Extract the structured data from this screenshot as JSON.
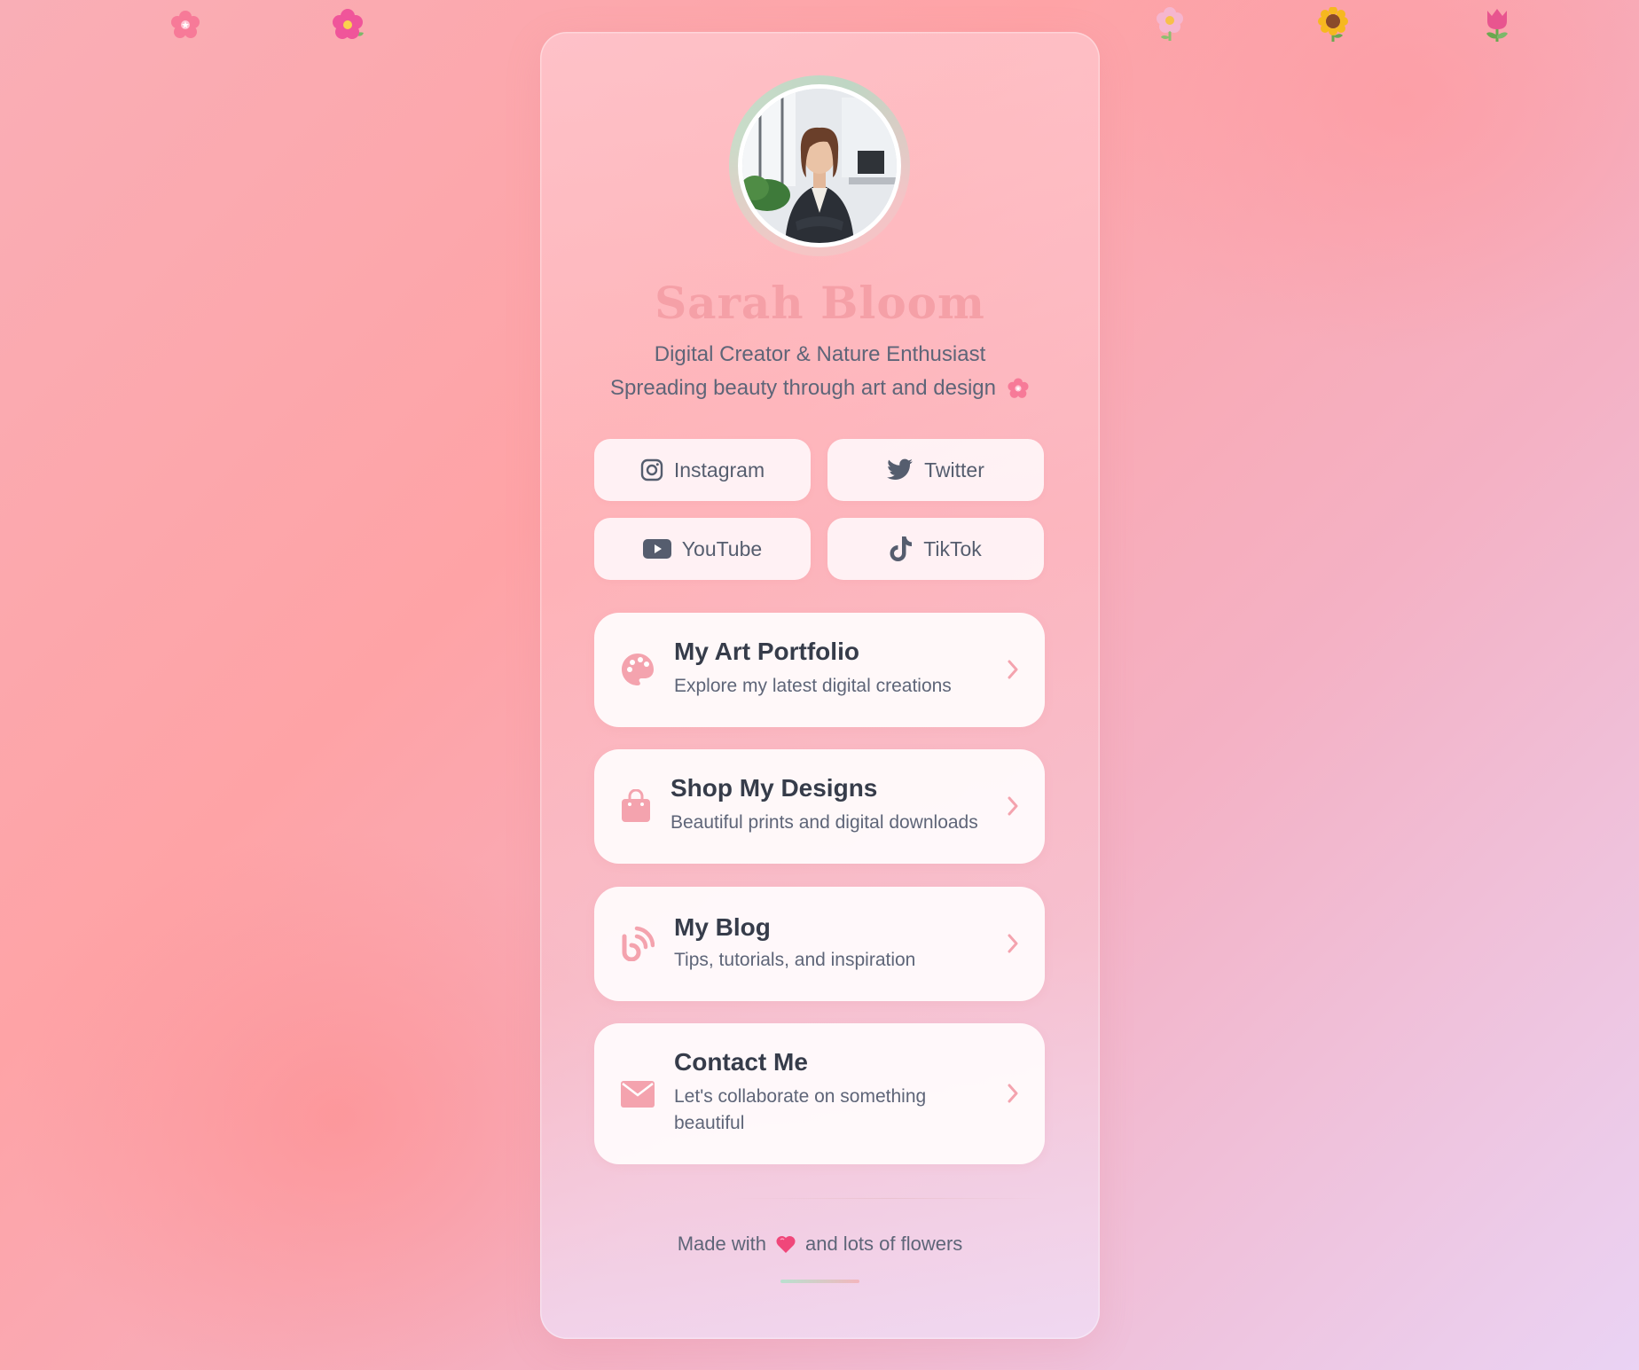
{
  "profile": {
    "name": "Sarah Bloom",
    "tagline_line1": "Digital Creator & Nature Enthusiast",
    "tagline_line2": "Spreading beauty through art and design"
  },
  "social": [
    {
      "label": "Instagram",
      "icon": "instagram-icon"
    },
    {
      "label": "Twitter",
      "icon": "twitter-icon"
    },
    {
      "label": "YouTube",
      "icon": "youtube-icon"
    },
    {
      "label": "TikTok",
      "icon": "tiktok-icon"
    }
  ],
  "links": [
    {
      "title": "My Art Portfolio",
      "description": "Explore my latest digital creations",
      "icon": "palette-icon"
    },
    {
      "title": "Shop My Designs",
      "description": "Beautiful prints and digital downloads",
      "icon": "shopping-bag-icon"
    },
    {
      "title": "My Blog",
      "description": "Tips, tutorials, and inspiration",
      "icon": "blog-feed-icon"
    },
    {
      "title": "Contact Me",
      "description_line1": "Let's collaborate on something",
      "description_line2": "beautiful",
      "icon": "envelope-icon"
    }
  ],
  "footer": {
    "before": "Made with",
    "after": "and lots of flowers"
  },
  "decorations": [
    "cherry-blossom-icon",
    "hibiscus-icon",
    "blossom-icon",
    "sunflower-icon",
    "tulip-icon"
  ],
  "colors": {
    "accent_pink": "#f5a0a7",
    "icon_pink": "#f4a3ae",
    "text_dark": "#363c4a",
    "text_muted": "#5e6578"
  }
}
